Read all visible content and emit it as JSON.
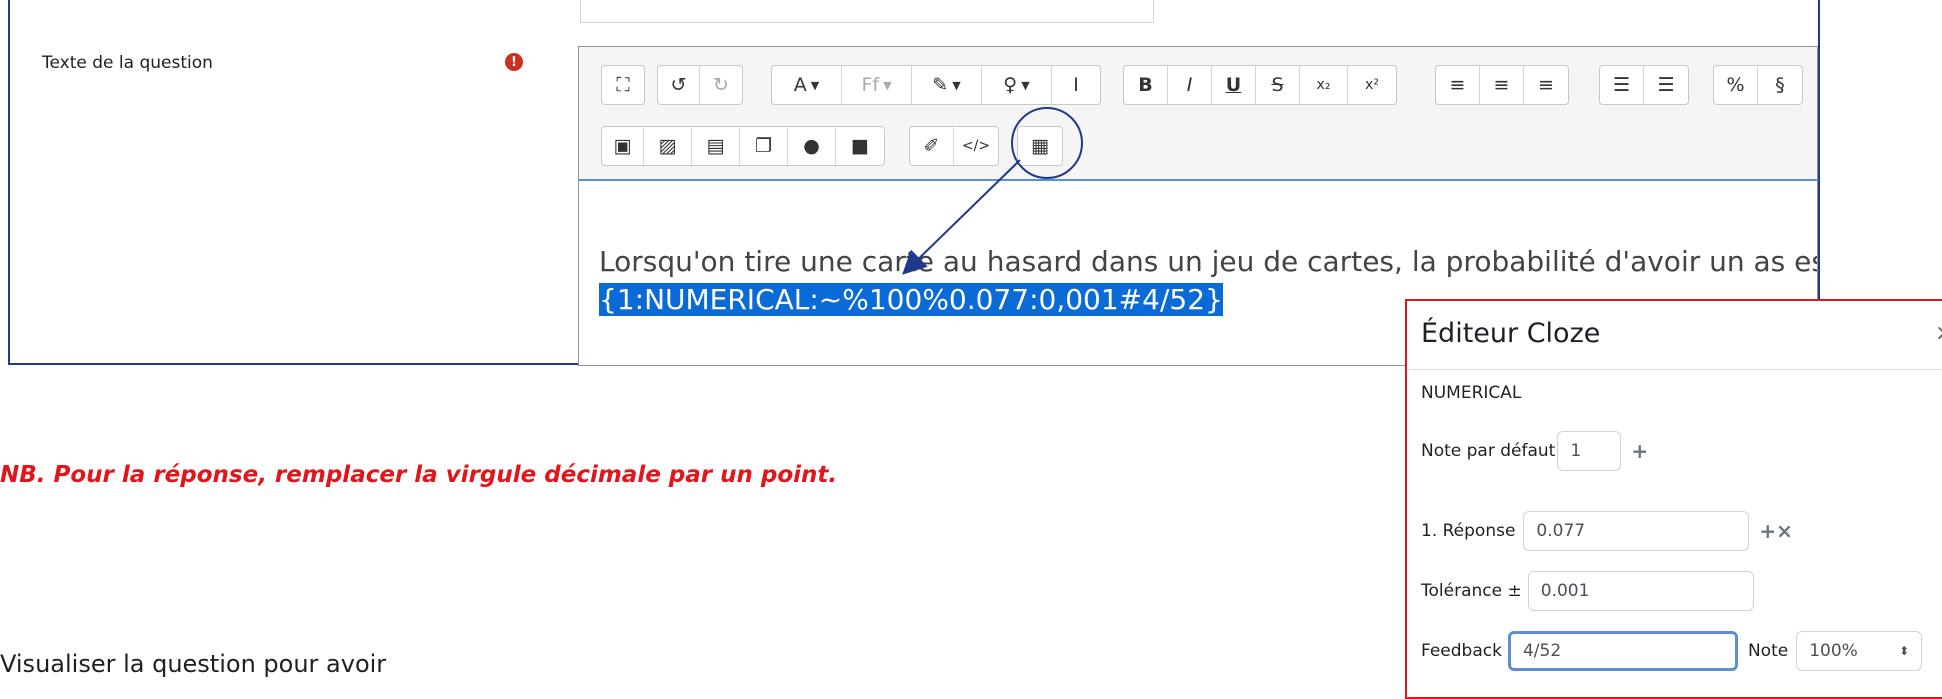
{
  "form": {
    "question_label": "Texte de la question",
    "required_icon": "!"
  },
  "toolbar": {
    "row1": [
      {
        "name": "fullscreen-button",
        "icon": "expand-icon",
        "glyph": "⛶"
      },
      {
        "name": "undo-button",
        "icon": "undo-icon",
        "glyph": "↺"
      },
      {
        "name": "redo-button",
        "icon": "redo-icon",
        "glyph": "↻"
      },
      {
        "name": "font-color-button",
        "icon": "font-color-icon",
        "glyph": "A"
      },
      {
        "name": "font-family-button",
        "icon": "font-family-icon",
        "glyph": "Ff"
      },
      {
        "name": "brush-button",
        "icon": "brush-icon",
        "glyph": "✎"
      },
      {
        "name": "highlight-button",
        "icon": "bulb-icon",
        "glyph": "♀"
      },
      {
        "name": "text-cursor-button",
        "icon": "text-cursor-icon",
        "glyph": "I"
      },
      {
        "name": "bold-button",
        "icon": "bold-icon",
        "glyph": "B"
      },
      {
        "name": "italic-button",
        "icon": "italic-icon",
        "glyph": "I"
      },
      {
        "name": "underline-button",
        "icon": "underline-icon",
        "glyph": "U"
      },
      {
        "name": "strikethrough-button",
        "icon": "strikethrough-icon",
        "glyph": "S"
      },
      {
        "name": "subscript-button",
        "icon": "subscript-icon",
        "glyph": "x₂"
      },
      {
        "name": "superscript-button",
        "icon": "superscript-icon",
        "glyph": "x²"
      },
      {
        "name": "align-left-button",
        "icon": "align-left-icon",
        "glyph": "≡"
      },
      {
        "name": "align-center-button",
        "icon": "align-center-icon",
        "glyph": "≡"
      },
      {
        "name": "align-right-button",
        "icon": "align-right-icon",
        "glyph": "≡"
      },
      {
        "name": "outdent-button",
        "icon": "outdent-icon",
        "glyph": "☰"
      },
      {
        "name": "indent-button",
        "icon": "indent-icon",
        "glyph": "☰"
      },
      {
        "name": "link-button",
        "icon": "link-icon",
        "glyph": "%"
      },
      {
        "name": "unlink-button",
        "icon": "unlink-icon",
        "glyph": "§"
      }
    ],
    "row2": [
      {
        "name": "paste-button",
        "icon": "paste-icon",
        "glyph": "▣"
      },
      {
        "name": "image-button",
        "icon": "image-icon",
        "glyph": "▨"
      },
      {
        "name": "media-button",
        "icon": "media-file-icon",
        "glyph": "▤"
      },
      {
        "name": "manage-files-button",
        "icon": "copy-files-icon",
        "glyph": "❐"
      },
      {
        "name": "record-audio-button",
        "icon": "microphone-icon",
        "glyph": "●"
      },
      {
        "name": "record-video-button",
        "icon": "video-camera-icon",
        "glyph": "■"
      },
      {
        "name": "edit-button",
        "icon": "edit-icon",
        "glyph": "✐"
      },
      {
        "name": "html-button",
        "icon": "code-icon",
        "glyph": "</>"
      },
      {
        "name": "cloze-editor-button",
        "icon": "cloze-icon",
        "glyph": "▦"
      }
    ]
  },
  "content": {
    "line1": "Lorsqu'on tire une carte au hasard dans un jeu de cartes, la probabilité d'avoir un as est de",
    "highlighted": "{1:NUMERICAL:~%100%0.077:0,001#4/52}"
  },
  "note": {
    "text": "NB. Pour la réponse, remplacer la virgule décimale par un point."
  },
  "bottom_text": "Visualiser la question pour avoir",
  "dialog": {
    "title": "Éditeur Cloze",
    "close": "×",
    "type": "NUMERICAL",
    "default_mark_label": "Note par défaut",
    "default_mark_value": "1",
    "answer_label": "1. Réponse",
    "answer_value": "0.077",
    "tolerance_label": "Tolérance ±",
    "tolerance_value": "0.001",
    "feedback_label": "Feedback",
    "feedback_value": "4/52",
    "grade_label": "Note",
    "grade_value": "100%"
  },
  "colors": {
    "frame": "#1f3a8a",
    "dialog_border": "#e3141a",
    "highlight": "#0a6ad6",
    "note": "#e3141a"
  }
}
